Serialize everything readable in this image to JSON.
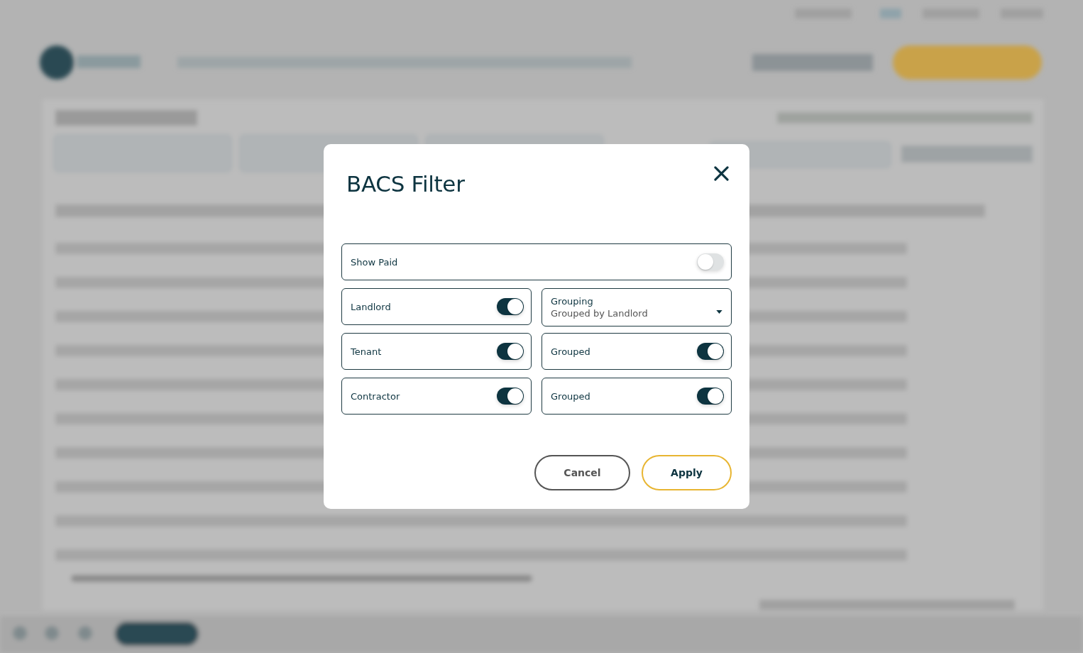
{
  "dialog": {
    "title": "BACS Filter",
    "show_paid": {
      "kind": "toggle",
      "label": "Show Paid",
      "on": false
    },
    "rows": [
      {
        "left": {
          "kind": "toggle",
          "label": "Landlord",
          "on": true
        },
        "right": {
          "kind": "select",
          "label": "Grouping",
          "value": "Grouped by Landlord"
        }
      },
      {
        "left": {
          "kind": "toggle",
          "label": "Tenant",
          "on": true
        },
        "right": {
          "kind": "toggle",
          "label": "Grouped",
          "on": true
        }
      },
      {
        "left": {
          "kind": "toggle",
          "label": "Contractor",
          "on": true
        },
        "right": {
          "kind": "toggle",
          "label": "Grouped",
          "on": true
        }
      }
    ],
    "buttons": [
      {
        "kind": "secondary",
        "label": "Cancel"
      },
      {
        "kind": "primary",
        "label": "Apply"
      }
    ]
  }
}
